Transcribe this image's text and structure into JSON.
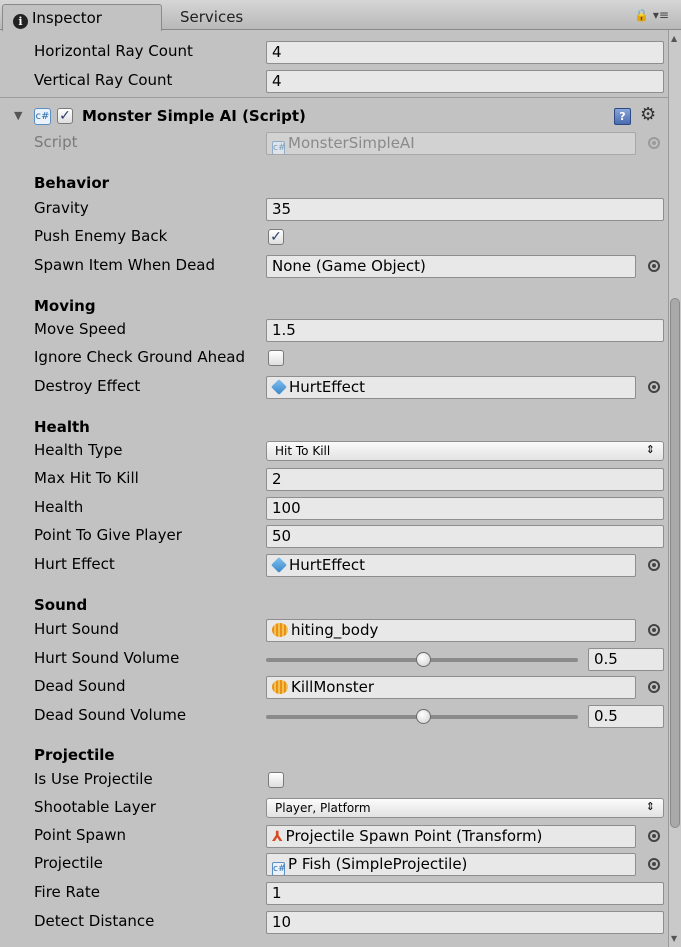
{
  "tabs": {
    "inspector": "Inspector",
    "services": "Services"
  },
  "top_rows": [
    {
      "label": "Horizontal Ray Count",
      "value": "4"
    },
    {
      "label": "Vertical Ray Count",
      "value": "4"
    }
  ],
  "component": {
    "title": "Monster Simple AI (Script)",
    "script_label": "Script",
    "script_value": "MonsterSimpleAI",
    "icon_glyph": "c#"
  },
  "behavior": {
    "header": "Behavior",
    "gravity_label": "Gravity",
    "gravity_value": "35",
    "push_enemy_back_label": "Push Enemy Back",
    "push_enemy_back_checked": true,
    "spawn_item_label": "Spawn Item When Dead",
    "spawn_item_value": "None (Game Object)"
  },
  "moving": {
    "header": "Moving",
    "move_speed_label": "Move Speed",
    "move_speed_value": "1.5",
    "ignore_check_label": "Ignore Check Ground Ahead",
    "ignore_check_checked": false,
    "destroy_effect_label": "Destroy Effect",
    "destroy_effect_value": "HurtEffect"
  },
  "health": {
    "header": "Health",
    "health_type_label": "Health Type",
    "health_type_value": "Hit To Kill",
    "max_hit_label": "Max Hit To Kill",
    "max_hit_value": "2",
    "health_label": "Health",
    "health_value": "100",
    "point_label": "Point To Give Player",
    "point_value": "50",
    "hurt_effect_label": "Hurt Effect",
    "hurt_effect_value": "HurtEffect"
  },
  "sound": {
    "header": "Sound",
    "hurt_sound_label": "Hurt Sound",
    "hurt_sound_value": "hiting_body",
    "hurt_volume_label": "Hurt Sound Volume",
    "hurt_volume_value": "0.5",
    "dead_sound_label": "Dead Sound",
    "dead_sound_value": "KillMonster",
    "dead_volume_label": "Dead Sound Volume",
    "dead_volume_value": "0.5"
  },
  "projectile": {
    "header": "Projectile",
    "is_use_label": "Is Use Projectile",
    "is_use_checked": false,
    "shootable_label": "Shootable Layer",
    "shootable_value": "Player, Platform",
    "point_spawn_label": "Point Spawn",
    "point_spawn_value": "Projectile Spawn Point (Transform)",
    "projectile_label": "Projectile",
    "projectile_value": "P Fish (SimpleProjectile)",
    "fire_rate_label": "Fire Rate",
    "fire_rate_value": "1",
    "detect_label": "Detect Distance",
    "detect_value": "10"
  },
  "glyphs": {
    "check": "✓",
    "dropdown_arrow": "⇕",
    "foldout": "▼",
    "gear": "⚙",
    "help": "?",
    "lock": "🔒 ▾≡"
  },
  "icons": {
    "tab_info": "info-icon",
    "lock": "lock-icon",
    "foldout": "foldout-arrow-icon",
    "script": "script-icon",
    "help": "help-icon",
    "gear": "gear-icon",
    "prefab": "prefab-icon",
    "audio": "audio-clip-icon",
    "transform": "transform-icon",
    "object_picker": "object-picker-icon"
  },
  "colors": {
    "background": "#c2c2c2",
    "field": "#e8e8e8",
    "accent": "#3a86c8",
    "audio": "#e89018"
  }
}
